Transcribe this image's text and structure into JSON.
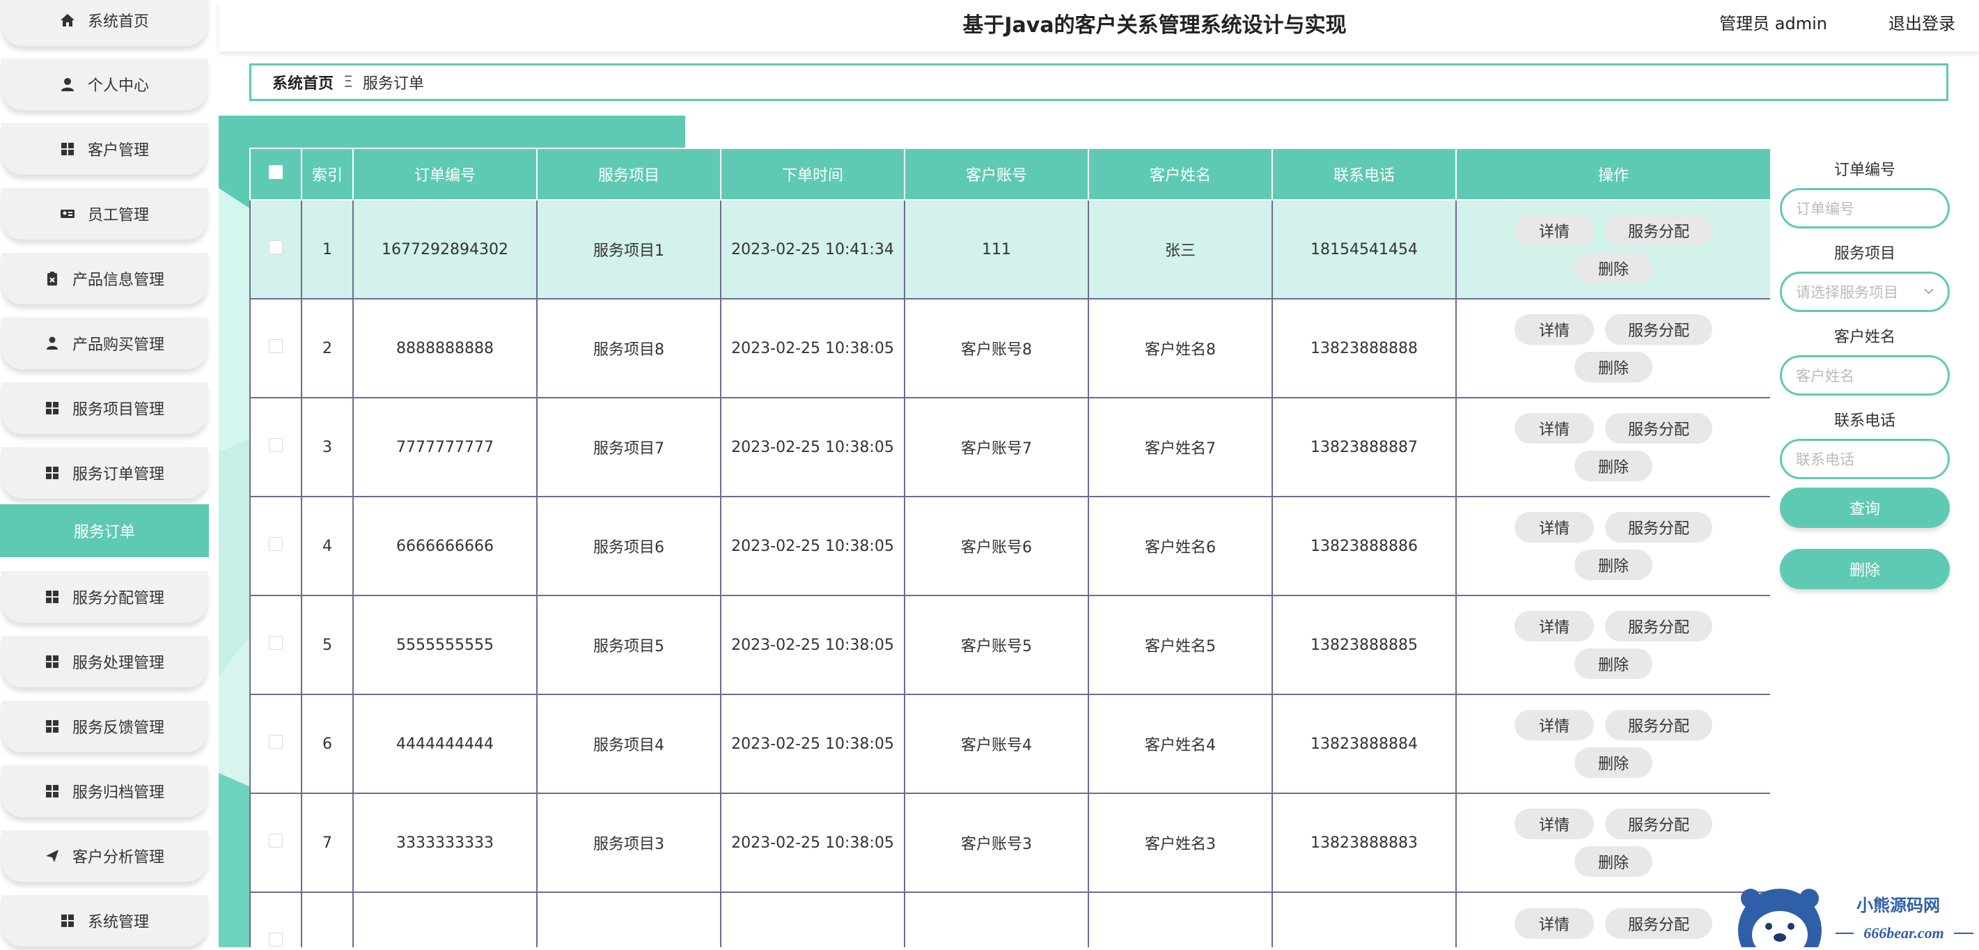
{
  "app": {
    "title": "基于Java的客户关系管理系统设计与实现",
    "user_label": "管理员 admin",
    "logout_label": "退出登录"
  },
  "sidebar": {
    "items": [
      {
        "label": "系统首页",
        "icon": "home-icon"
      },
      {
        "label": "个人中心",
        "icon": "user-icon"
      },
      {
        "label": "客户管理",
        "icon": "grid-icon"
      },
      {
        "label": "员工管理",
        "icon": "id-card-icon"
      },
      {
        "label": "产品信息管理",
        "icon": "clipboard-icon"
      },
      {
        "label": "产品购买管理",
        "icon": "person-icon"
      },
      {
        "label": "服务项目管理",
        "icon": "grid-icon"
      },
      {
        "label": "服务订单管理",
        "icon": "grid-icon"
      },
      {
        "label": "服务分配管理",
        "icon": "grid-icon"
      },
      {
        "label": "服务处理管理",
        "icon": "grid-icon"
      },
      {
        "label": "服务反馈管理",
        "icon": "grid-icon"
      },
      {
        "label": "服务归档管理",
        "icon": "grid-icon"
      },
      {
        "label": "客户分析管理",
        "icon": "send-icon"
      },
      {
        "label": "系统管理",
        "icon": "grid-icon"
      }
    ],
    "active_sub": "服务订单"
  },
  "breadcrumb": {
    "home": "系统首页",
    "separator": "Ξ",
    "current": "服务订单"
  },
  "table": {
    "columns": [
      "索引",
      "订单编号",
      "服务项目",
      "下单时间",
      "客户账号",
      "客户姓名",
      "联系电话",
      "操作"
    ],
    "rows": [
      {
        "index": "1",
        "order_no": "1677292894302",
        "service": "服务项目1",
        "time": "2023-02-25 10:41:34",
        "account": "111",
        "name": "张三",
        "phone": "18154541454"
      },
      {
        "index": "2",
        "order_no": "8888888888",
        "service": "服务项目8",
        "time": "2023-02-25 10:38:05",
        "account": "客户账号8",
        "name": "客户姓名8",
        "phone": "13823888888"
      },
      {
        "index": "3",
        "order_no": "7777777777",
        "service": "服务项目7",
        "time": "2023-02-25 10:38:05",
        "account": "客户账号7",
        "name": "客户姓名7",
        "phone": "13823888887"
      },
      {
        "index": "4",
        "order_no": "6666666666",
        "service": "服务项目6",
        "time": "2023-02-25 10:38:05",
        "account": "客户账号6",
        "name": "客户姓名6",
        "phone": "13823888886"
      },
      {
        "index": "5",
        "order_no": "5555555555",
        "service": "服务项目5",
        "time": "2023-02-25 10:38:05",
        "account": "客户账号5",
        "name": "客户姓名5",
        "phone": "13823888885"
      },
      {
        "index": "6",
        "order_no": "4444444444",
        "service": "服务项目4",
        "time": "2023-02-25 10:38:05",
        "account": "客户账号4",
        "name": "客户姓名4",
        "phone": "13823888884"
      },
      {
        "index": "7",
        "order_no": "3333333333",
        "service": "服务项目3",
        "time": "2023-02-25 10:38:05",
        "account": "客户账号3",
        "name": "客户姓名3",
        "phone": "13823888883"
      },
      {
        "index": "",
        "order_no": "",
        "service": "",
        "time": "",
        "account": "",
        "name": "",
        "phone": ""
      }
    ],
    "ops": {
      "detail": "详情",
      "assign": "服务分配",
      "delete": "删除"
    }
  },
  "search": {
    "order_no_label": "订单编号",
    "order_no_placeholder": "订单编号",
    "service_label": "服务项目",
    "service_placeholder": "请选择服务项目",
    "name_label": "客户姓名",
    "name_placeholder": "客户姓名",
    "phone_label": "联系电话",
    "phone_placeholder": "联系电话",
    "query_button": "查询",
    "delete_button": "删除"
  },
  "watermark": {
    "brand": "小熊源码网",
    "domain": "666bear.com"
  },
  "colors": {
    "accent": "#5fcab3",
    "row_highlight": "#d3f2eb",
    "button_gray": "#e8e8e8",
    "grid_line": "#6e6b91"
  }
}
